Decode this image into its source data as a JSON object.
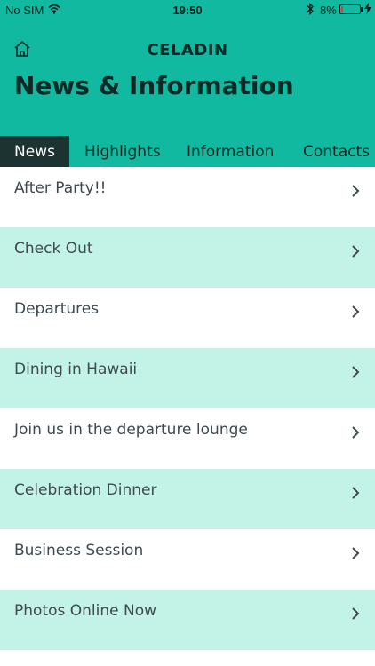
{
  "status_bar": {
    "carrier": "No SIM",
    "time": "19:50",
    "battery_percent": "8%",
    "battery_level": 0.08,
    "icons": [
      "wifi-icon",
      "bluetooth-icon",
      "battery-icon",
      "charging-icon"
    ]
  },
  "header": {
    "brand": "CELADIN",
    "title": "News & Information",
    "home_icon": "home-icon"
  },
  "tabs": [
    {
      "label": "News",
      "active": true
    },
    {
      "label": "Highlights",
      "active": false
    },
    {
      "label": "Information",
      "active": false
    },
    {
      "label": "Contacts",
      "active": false
    }
  ],
  "items": [
    {
      "label": "After Party!!"
    },
    {
      "label": "Check Out"
    },
    {
      "label": "Departures"
    },
    {
      "label": "Dining in Hawaii"
    },
    {
      "label": "Join us in the departure lounge"
    },
    {
      "label": "Celebration Dinner"
    },
    {
      "label": "Business Session"
    },
    {
      "label": "Photos Online Now"
    }
  ],
  "colors": {
    "header_bg": "#10b9a0",
    "active_tab_bg": "#1c3331",
    "alt_row_bg": "#c3f2e6",
    "battery_low": "#e23b2e"
  }
}
